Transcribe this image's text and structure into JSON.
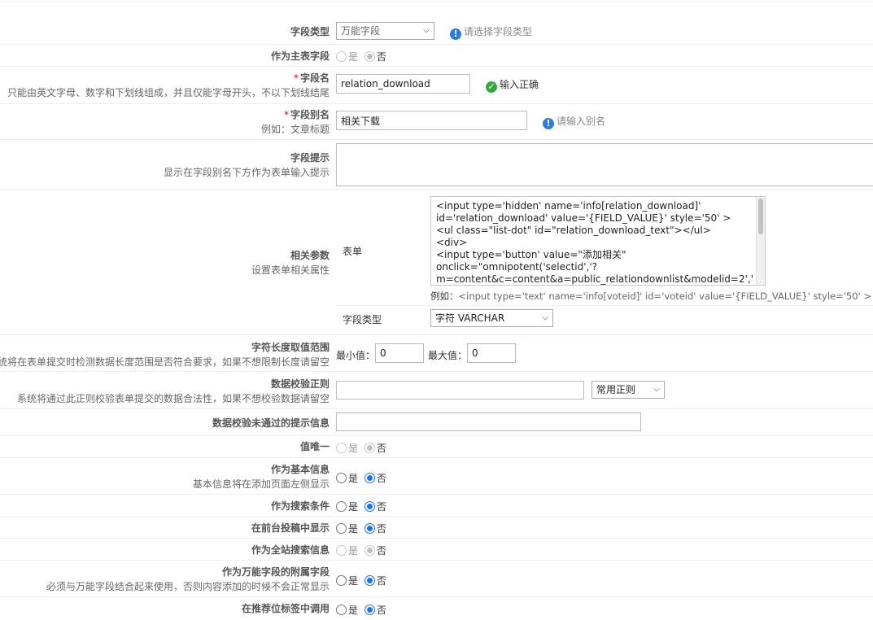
{
  "fields": {
    "field_type": {
      "label": "字段类型",
      "value": "万能字段",
      "tip": "请选择字段类型"
    },
    "main_table": {
      "label": "作为主表字段",
      "opt_yes": "是",
      "opt_no": "否"
    },
    "field_name": {
      "label": "字段名",
      "sub": "只能由英文字母、数字和下划线组成，并且仅能字母开头，不以下划线结尾",
      "value": "relation_download",
      "tip": "输入正确"
    },
    "field_alias": {
      "label": "字段别名",
      "sub": "例如：文章标题",
      "value": "相关下载",
      "tip": "请输入别名"
    },
    "field_hint": {
      "label": "字段提示",
      "sub": "显示在字段别名下方作为表单输入提示"
    },
    "params": {
      "label": "相关参数",
      "sub": "设置表单相关属性",
      "form_label": "表单",
      "code_lines": [
        "<input type='hidden' name='info[relation_download]'",
        "id='relation_download' value='{FIELD_VALUE}' style='50' >",
        "<ul class=\"list-dot\" id=\"relation_download_text\"></ul>",
        "<div>",
        "<input type='button' value=\"添加相关\"",
        "onclick=\"omnipotent('selectid','?",
        "m=content&c=content&a=public_relationdownlist&modelid=2','"
      ],
      "example_prefix": "例如：",
      "example_code": "<input type='text' name='info[voteid]' id='voteid' value='{FIELD_VALUE}' style='50' >",
      "type_label": "字段类型",
      "type_value": "字符 VARCHAR"
    },
    "length_range": {
      "label": "字符长度取值范围",
      "sub": "系统将在表单提交时检测数据长度范围是否符合要求，如果不想限制长度请留空",
      "min_label": "最小值：",
      "min_value": "0",
      "max_label": "最大值：",
      "max_value": "0"
    },
    "regex": {
      "label": "数据校验正则",
      "sub": "系统将通过此正则校验表单提交的数据合法性，如果不想校验数据请留空",
      "select_value": "常用正则"
    },
    "error_msg": {
      "label": "数据校验未通过的提示信息"
    },
    "unique": {
      "label": "值唯一",
      "opt_yes": "是",
      "opt_no": "否"
    },
    "basic_info": {
      "label": "作为基本信息",
      "sub": "基本信息将在添加页面左侧显示",
      "opt_yes": "是",
      "opt_no": "否"
    },
    "search_cond": {
      "label": "作为搜索条件",
      "opt_yes": "是",
      "opt_no": "否"
    },
    "front_show": {
      "label": "在前台投稿中显示",
      "opt_yes": "是",
      "opt_no": "否"
    },
    "site_search": {
      "label": "作为全站搜索信息",
      "opt_yes": "是",
      "opt_no": "否"
    },
    "attached": {
      "label": "作为万能字段的附属字段",
      "sub": "必须与万能字段结合起来使用，否则内容添加的时候不会正常显示",
      "opt_yes": "是",
      "opt_no": "否"
    },
    "position_tag": {
      "label": "在推荐位标签中调用",
      "opt_yes": "是",
      "opt_no": "否"
    }
  },
  "colors": {
    "required_star": "#e60012",
    "ok_icon": "#3aa63f",
    "info_icon": "#2b7de0",
    "radio_checked": "#1a73e8"
  },
  "icons": {
    "info": "exclamation-circle-icon",
    "ok": "check-circle-icon"
  }
}
